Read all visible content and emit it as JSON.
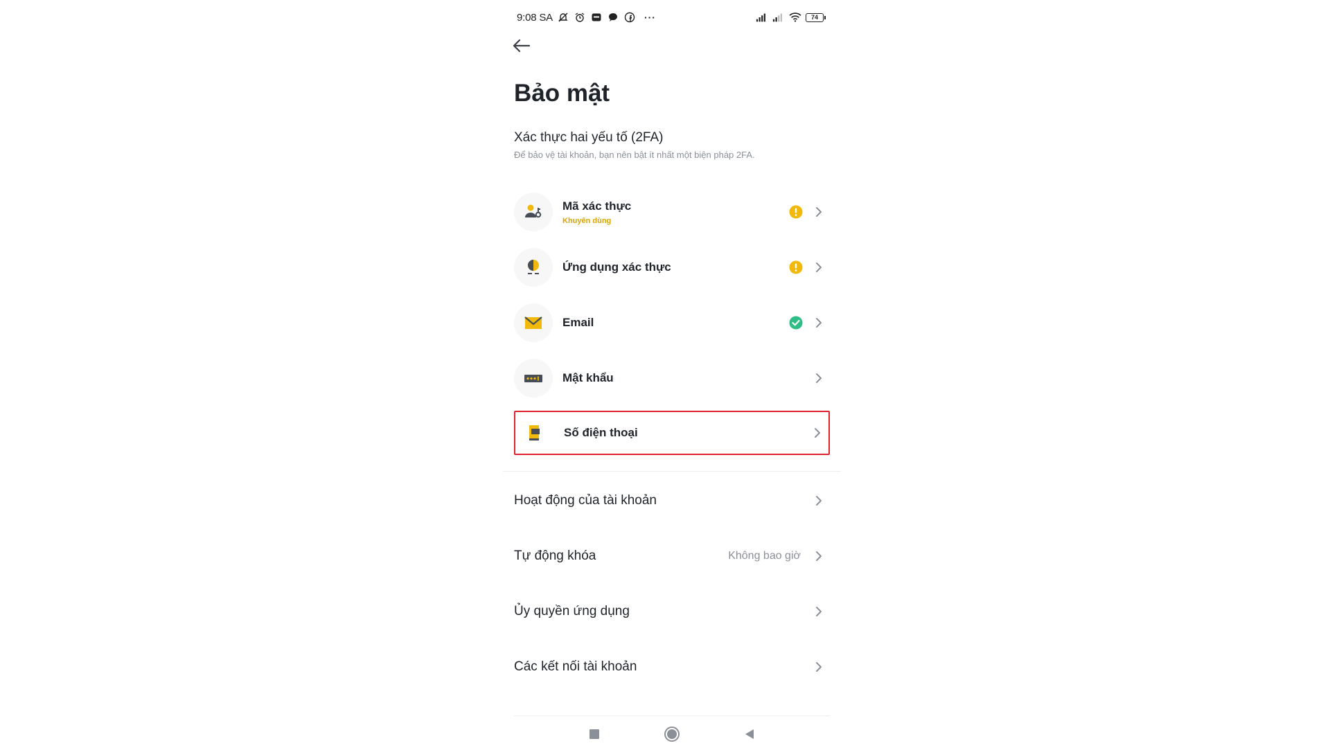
{
  "status_bar": {
    "time": "9:08 SA",
    "battery": "74",
    "icons": [
      "mute-icon",
      "alarm-icon",
      "zalo-icon",
      "chat-icon",
      "facebook-icon"
    ],
    "more": "···"
  },
  "header": {
    "back_icon": "arrow-left-icon",
    "title": "Bảo mật"
  },
  "two_fa": {
    "title": "Xác thực hai yếu tố (2FA)",
    "subtitle": "Để bảo vệ tài khoản, bạn nên bật ít nhất một biện pháp 2FA.",
    "items": [
      {
        "label": "Mã xác thực",
        "badge": "Khuyên dùng",
        "status": "warning",
        "icon": "passkey-icon"
      },
      {
        "label": "Ứng dụng xác thực",
        "badge": "",
        "status": "warning",
        "icon": "authenticator-icon"
      },
      {
        "label": "Email",
        "badge": "",
        "status": "verified",
        "icon": "envelope-icon"
      },
      {
        "label": "Mật khẩu",
        "badge": "",
        "status": "none",
        "icon": "password-icon"
      },
      {
        "label": "Số điện thoại",
        "badge": "",
        "status": "none",
        "icon": "phone-icon",
        "highlighted": true
      }
    ]
  },
  "other_settings": [
    {
      "label": "Hoạt động của tài khoản",
      "value": ""
    },
    {
      "label": "Tự động khóa",
      "value": "Không bao giờ"
    },
    {
      "label": "Ủy quyền ứng dụng",
      "value": ""
    },
    {
      "label": "Các kết nối tài khoản",
      "value": ""
    }
  ],
  "colors": {
    "accent_yellow": "#f0b90b",
    "warning": "#f0b90b",
    "success": "#2ebd85",
    "highlight_border": "#e0202c",
    "text_primary": "#1e2329",
    "text_secondary": "#8a8f98"
  },
  "nav_bar": {
    "icons": [
      "recent-apps-icon",
      "home-icon",
      "back-nav-icon"
    ]
  }
}
